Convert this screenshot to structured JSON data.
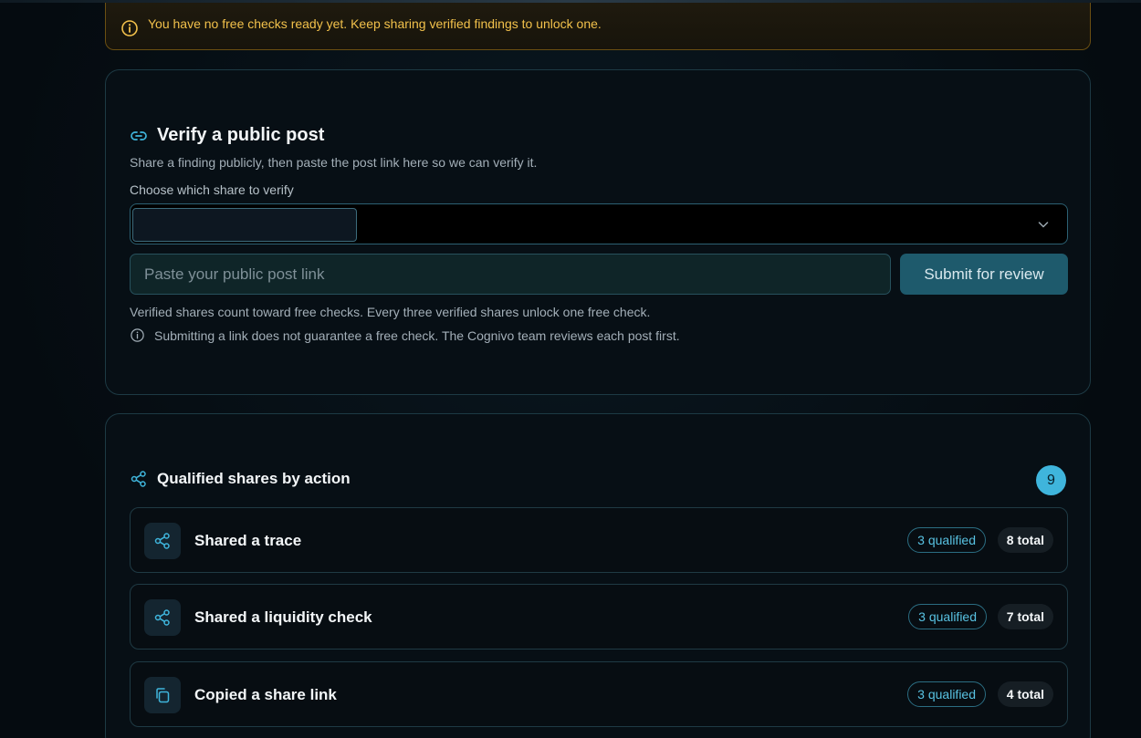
{
  "alert": {
    "text": "You have no free checks ready yet. Keep sharing verified findings to unlock one.",
    "icon": "info-circle-icon",
    "color": "#f2c14b"
  },
  "verify": {
    "title": "Verify a public post",
    "subtitle": "Share a finding publicly, then paste the post link here so we can verify it.",
    "choose_label": "Choose which share to verify",
    "selected_value": "",
    "link_placeholder": "Paste your public post link",
    "submit_label": "Submit for review",
    "note": "Verified shares count toward free checks. Every three verified shares unlock one free check.",
    "disclaimer": "Submitting a link does not guarantee a free check. The Cognivo team reviews each post first."
  },
  "qualified": {
    "title": "Qualified shares by action",
    "count": "9",
    "accent": "#3fb5dc",
    "rows": [
      {
        "label": "Shared a trace",
        "qualified": "3 qualified",
        "total": "8 total",
        "icon": "share-icon"
      },
      {
        "label": "Shared a liquidity check",
        "qualified": "3 qualified",
        "total": "7 total",
        "icon": "share-icon"
      },
      {
        "label": "Copied a share link",
        "qualified": "3 qualified",
        "total": "4 total",
        "icon": "copy-icon"
      }
    ]
  }
}
